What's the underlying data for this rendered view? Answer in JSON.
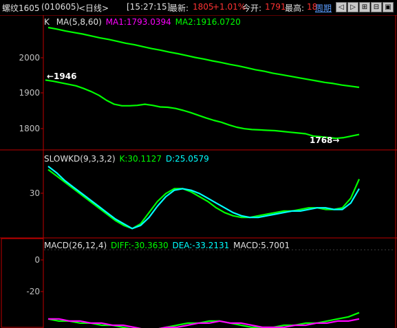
{
  "header": {
    "symbol": "螺纹1605",
    "code": "(010605)",
    "period": "<日线>",
    "time": "[15:27:15]",
    "latest_label": "最新:",
    "latest_value": "1805",
    "change": "+1.01%",
    "open_label": "今开:",
    "open_value": "1791",
    "high_label": "最高:",
    "high_value": "18",
    "cycle_link": "周期",
    "nav_buttons": [
      "prev-icon",
      "next-icon",
      "zoom-in-icon",
      "zoom-out-icon",
      "restore-icon"
    ]
  },
  "panels": {
    "price": {
      "k_label": "K",
      "ma_label": "MA(5,8,60)",
      "ma1": "MA1:1793.0394",
      "ma2": "MA2:1916.0720",
      "y_ticks": [
        "2000",
        "1900",
        "1800"
      ],
      "high_note": "←1946",
      "low_note": "1768→"
    },
    "kd": {
      "title": "SLOWKD(9,3,3,2)",
      "k": "K:30.1127",
      "d": "D:25.0579",
      "y_ticks": [
        "30"
      ]
    },
    "macd": {
      "title": "MACD(26,12,4)",
      "diff": "DIFF:-30.3630",
      "dea": "DEA:-33.2131",
      "macd": "MACD:5.7001",
      "y_ticks": [
        "0",
        "-20"
      ]
    }
  },
  "colors": {
    "up": "#ff3232",
    "down": "#00ffff",
    "ma1": "#ff00ff",
    "ma2": "#00ff00",
    "axis": "#c00000",
    "text": "#c0c0c0"
  },
  "chart_data": [
    {
      "type": "line",
      "title": "MA(5,8,60)",
      "series": [
        {
          "name": "MA1",
          "values": [
            1935,
            1932,
            1928,
            1924,
            1920,
            1913,
            1905,
            1895,
            1882,
            1872,
            1868,
            1868,
            1869,
            1872,
            1869,
            1865,
            1864,
            1861,
            1856,
            1850,
            1843,
            1836,
            1830,
            1825,
            1818,
            1812,
            1808,
            1806,
            1805,
            1804,
            1803,
            1801,
            1799,
            1797,
            1795,
            1789,
            1787,
            1785,
            1783,
            1785,
            1789,
            1793
          ]
        },
        {
          "name": "MA2",
          "values": [
            2072,
            2068,
            2063,
            2059,
            2055,
            2050,
            2045,
            2041,
            2036,
            2031,
            2027,
            2022,
            2017,
            2013,
            2008,
            2004,
            1999,
            1994,
            1990,
            1985,
            1981,
            1976,
            1972,
            1967,
            1962,
            1958,
            1953,
            1949,
            1945,
            1941,
            1937,
            1933,
            1929,
            1926,
            1922,
            1919,
            1916
          ]
        }
      ],
      "ylim": [
        1760,
        2090
      ]
    },
    {
      "type": "line",
      "title": "SLOWKD(9,3,3,2)",
      "series": [
        {
          "name": "K",
          "values": [
            42,
            38,
            34,
            30,
            26,
            22,
            18,
            14,
            10,
            7,
            5,
            8,
            15,
            22,
            27,
            30,
            30,
            28,
            25,
            22,
            18,
            15,
            13,
            12,
            12,
            13,
            14,
            15,
            16,
            16,
            17,
            18,
            18,
            17,
            17,
            18,
            24,
            36
          ]
        },
        {
          "name": "D",
          "values": [
            44,
            40,
            35,
            31,
            27,
            23,
            19,
            15,
            11,
            8,
            5,
            7,
            12,
            19,
            25,
            29,
            30,
            29,
            27,
            24,
            21,
            18,
            15,
            13,
            12,
            12,
            13,
            14,
            15,
            16,
            16,
            17,
            18,
            18,
            17,
            17,
            21,
            30
          ]
        }
      ],
      "ylim": [
        0,
        50
      ]
    },
    {
      "type": "line",
      "title": "MACD(26,12,4)",
      "series": [
        {
          "name": "DIFF",
          "values": [
            -33,
            -34,
            -34,
            -35,
            -35,
            -36,
            -36,
            -37,
            -38,
            -39,
            -38,
            -37,
            -36,
            -35,
            -35,
            -34,
            -34,
            -35,
            -36,
            -37,
            -37,
            -37,
            -36,
            -36,
            -35,
            -35,
            -34,
            -33,
            -32,
            -30
          ]
        },
        {
          "name": "DEA",
          "values": [
            -33,
            -33,
            -34,
            -34,
            -35,
            -35,
            -36,
            -36,
            -37,
            -38,
            -38,
            -37,
            -37,
            -36,
            -35,
            -35,
            -34,
            -35,
            -35,
            -36,
            -37,
            -37,
            -37,
            -36,
            -36,
            -35,
            -35,
            -34,
            -34,
            -33
          ]
        }
      ],
      "ylim": [
        -37,
        5
      ]
    }
  ]
}
